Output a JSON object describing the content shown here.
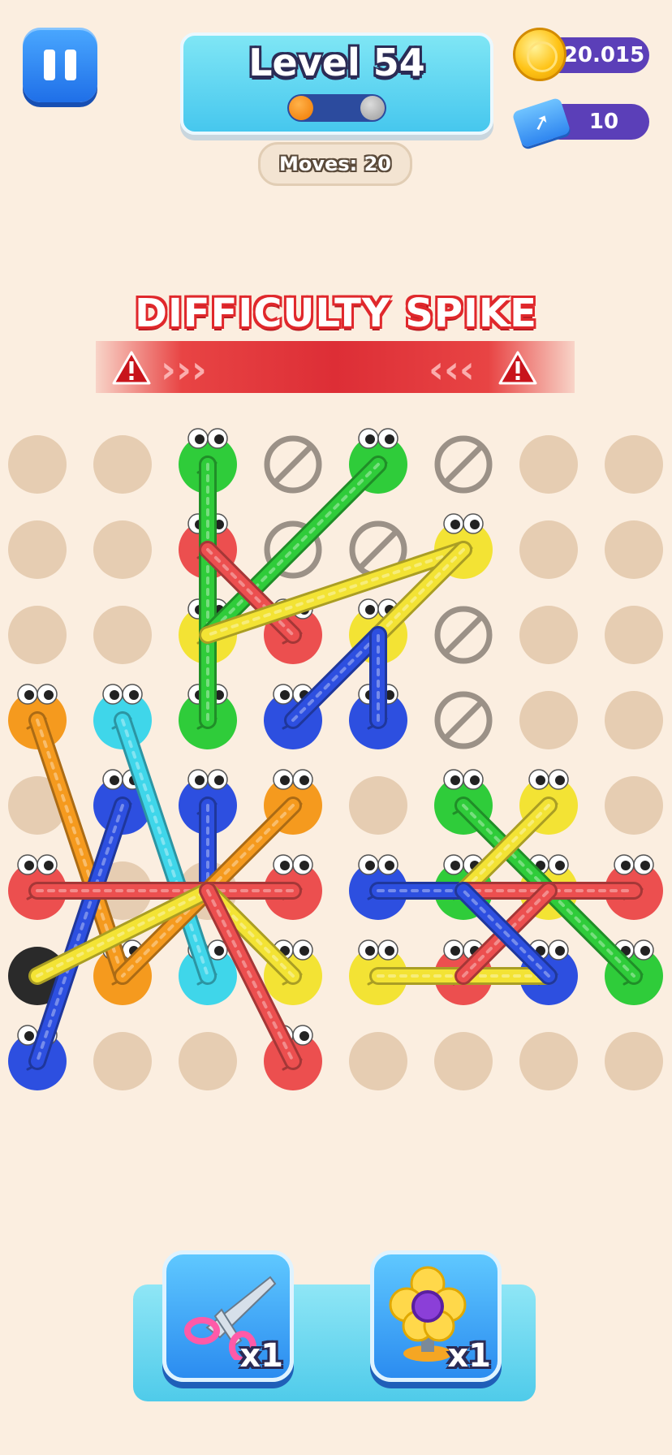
{
  "header": {
    "level_label": "Level 54",
    "moves_label": "Moves: 20",
    "coins": "20.015",
    "tickets": "10"
  },
  "banner": {
    "text": "DIFFICULTY SPIKE"
  },
  "boosters": [
    {
      "name": "scissors",
      "count": "x1"
    },
    {
      "name": "screw",
      "count": "x1"
    }
  ],
  "colors": {
    "green": "#2fcc3a",
    "red": "#ec4f4f",
    "yellow": "#f3e334",
    "blue": "#2d4fe0",
    "cyan": "#3fd6ea",
    "orange": "#f59a1e",
    "black": "#2a2a2a",
    "empty": "#e6cdb2",
    "blocked": "#9b9187"
  },
  "board": {
    "columns": 8,
    "rows": 8,
    "cells": [
      "empty",
      "empty",
      "green",
      "blocked",
      "green",
      "blocked",
      "empty",
      "empty",
      "empty",
      "empty",
      "red",
      "blocked",
      "blocked",
      "yellow",
      "empty",
      "empty",
      "empty",
      "empty",
      "yellow",
      "red",
      "yellow",
      "blocked",
      "empty",
      "empty",
      "orange",
      "cyan",
      "green",
      "blue",
      "blue",
      "blocked",
      "empty",
      "empty",
      "empty",
      "blue",
      "blue",
      "orange",
      "empty",
      "green",
      "yellow",
      "empty",
      "red",
      "empty",
      "empty",
      "red",
      "blue",
      "green",
      "yellow",
      "red",
      "black",
      "orange",
      "cyan",
      "yellow",
      "yellow",
      "red",
      "blue",
      "green",
      "blue",
      "empty",
      "empty",
      "red",
      "empty",
      "empty",
      "empty",
      "empty"
    ],
    "ropes": [
      {
        "color": "green",
        "from": [
          2,
          0
        ],
        "to": [
          2,
          3
        ]
      },
      {
        "color": "green",
        "from": [
          4,
          0
        ],
        "to": [
          2,
          2
        ]
      },
      {
        "color": "red",
        "from": [
          2,
          1
        ],
        "to": [
          3,
          2
        ]
      },
      {
        "color": "yellow",
        "from": [
          5,
          1
        ],
        "to": [
          2,
          2
        ]
      },
      {
        "color": "yellow",
        "from": [
          5,
          1
        ],
        "to": [
          4,
          2
        ]
      },
      {
        "color": "blue",
        "from": [
          3,
          3
        ],
        "to": [
          4,
          2
        ]
      },
      {
        "color": "blue",
        "from": [
          4,
          3
        ],
        "to": [
          4,
          2
        ]
      },
      {
        "color": "orange",
        "from": [
          0,
          3
        ],
        "to": [
          1,
          6
        ]
      },
      {
        "color": "cyan",
        "from": [
          1,
          3
        ],
        "to": [
          2,
          6
        ]
      },
      {
        "color": "blue",
        "from": [
          1,
          4
        ],
        "to": [
          0,
          7
        ]
      },
      {
        "color": "blue",
        "from": [
          2,
          4
        ],
        "to": [
          2,
          5
        ]
      },
      {
        "color": "orange",
        "from": [
          3,
          4
        ],
        "to": [
          1,
          6
        ]
      },
      {
        "color": "red",
        "from": [
          0,
          5
        ],
        "to": [
          3,
          5
        ]
      },
      {
        "color": "yellow",
        "from": [
          0,
          6
        ],
        "to": [
          2,
          5
        ]
      },
      {
        "color": "yellow",
        "from": [
          3,
          6
        ],
        "to": [
          2,
          5
        ]
      },
      {
        "color": "red",
        "from": [
          2,
          5
        ],
        "to": [
          3,
          7
        ]
      },
      {
        "color": "blue",
        "from": [
          4,
          5
        ],
        "to": [
          5,
          5
        ]
      },
      {
        "color": "green",
        "from": [
          5,
          4
        ],
        "to": [
          7,
          6
        ]
      },
      {
        "color": "yellow",
        "from": [
          6,
          4
        ],
        "to": [
          5,
          5
        ]
      },
      {
        "color": "red",
        "from": [
          5,
          5
        ],
        "to": [
          7,
          5
        ]
      },
      {
        "color": "yellow",
        "from": [
          4,
          6
        ],
        "to": [
          6,
          6
        ]
      },
      {
        "color": "red",
        "from": [
          5,
          6
        ],
        "to": [
          6,
          5
        ]
      },
      {
        "color": "blue",
        "from": [
          6,
          6
        ],
        "to": [
          5,
          5
        ]
      }
    ]
  }
}
